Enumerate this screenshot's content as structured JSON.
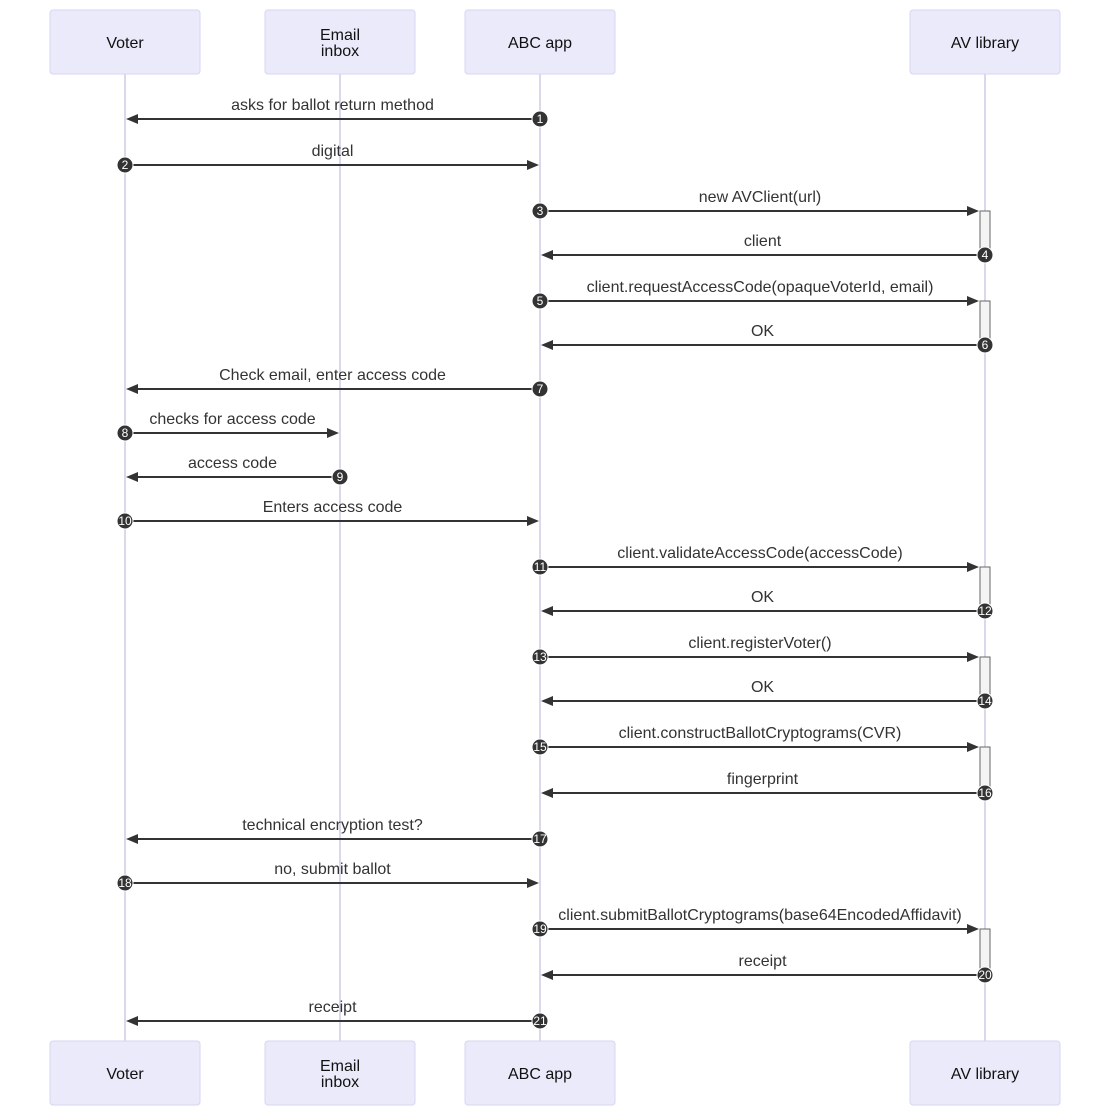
{
  "diagram": {
    "type": "sequence",
    "actors": [
      {
        "id": "voter",
        "label_lines": [
          "Voter"
        ]
      },
      {
        "id": "email",
        "label_lines": [
          "Email",
          "inbox"
        ]
      },
      {
        "id": "abc",
        "label_lines": [
          "ABC app"
        ]
      },
      {
        "id": "av",
        "label_lines": [
          "AV library"
        ]
      }
    ],
    "messages": [
      {
        "seq": "1",
        "from": "abc",
        "to": "voter",
        "text": "asks for ballot return method"
      },
      {
        "seq": "2",
        "from": "voter",
        "to": "abc",
        "text": "digital"
      },
      {
        "seq": "3",
        "from": "abc",
        "to": "av",
        "text": "new AVClient(url)",
        "activate": true
      },
      {
        "seq": "4",
        "from": "av",
        "to": "abc",
        "text": "client"
      },
      {
        "seq": "5",
        "from": "abc",
        "to": "av",
        "text": "client.requestAccessCode(opaqueVoterId, email)",
        "activate": true
      },
      {
        "seq": "6",
        "from": "av",
        "to": "abc",
        "text": "OK"
      },
      {
        "seq": "7",
        "from": "abc",
        "to": "voter",
        "text": "Check email, enter access code"
      },
      {
        "seq": "8",
        "from": "voter",
        "to": "email",
        "text": "checks for access code"
      },
      {
        "seq": "9",
        "from": "email",
        "to": "voter",
        "text": "access code"
      },
      {
        "seq": "10",
        "from": "voter",
        "to": "abc",
        "text": "Enters access code"
      },
      {
        "seq": "11",
        "from": "abc",
        "to": "av",
        "text": "client.validateAccessCode(accessCode)",
        "activate": true
      },
      {
        "seq": "12",
        "from": "av",
        "to": "abc",
        "text": "OK"
      },
      {
        "seq": "13",
        "from": "abc",
        "to": "av",
        "text": "client.registerVoter()",
        "activate": true
      },
      {
        "seq": "14",
        "from": "av",
        "to": "abc",
        "text": "OK"
      },
      {
        "seq": "15",
        "from": "abc",
        "to": "av",
        "text": "client.constructBallotCryptograms(CVR)",
        "activate": true
      },
      {
        "seq": "16",
        "from": "av",
        "to": "abc",
        "text": "fingerprint"
      },
      {
        "seq": "17",
        "from": "abc",
        "to": "voter",
        "text": "technical encryption test?"
      },
      {
        "seq": "18",
        "from": "voter",
        "to": "abc",
        "text": "no, submit ballot"
      },
      {
        "seq": "19",
        "from": "abc",
        "to": "av",
        "text": "client.submitBallotCryptograms(base64EncodedAffidavit)",
        "activate": true
      },
      {
        "seq": "20",
        "from": "av",
        "to": "abc",
        "text": "receipt"
      },
      {
        "seq": "21",
        "from": "abc",
        "to": "voter",
        "text": "receipt"
      }
    ]
  }
}
